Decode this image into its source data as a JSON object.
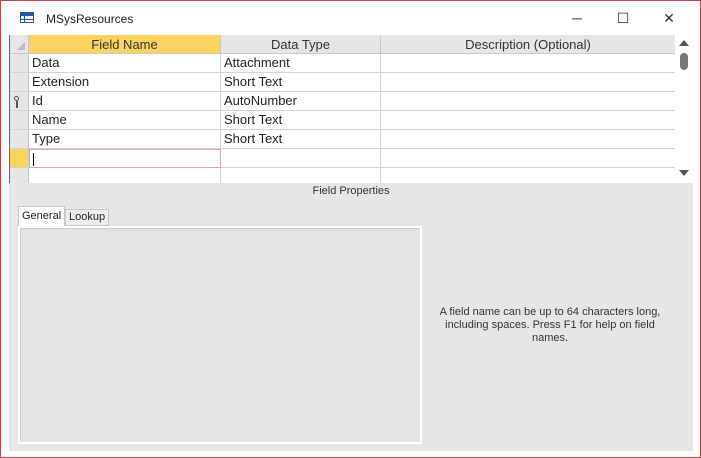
{
  "window": {
    "title": "MSysResources",
    "title_icon": "table-icon"
  },
  "controls": {
    "minimize": "─",
    "maximize": "☐",
    "close": "✕"
  },
  "grid": {
    "columns": [
      "Field Name",
      "Data Type",
      "Description (Optional)"
    ],
    "rows": [
      {
        "field": "Data",
        "type": "Attachment",
        "description": "",
        "primary_key": false
      },
      {
        "field": "Extension",
        "type": "Short Text",
        "description": "",
        "primary_key": false
      },
      {
        "field": "Id",
        "type": "AutoNumber",
        "description": "",
        "primary_key": true
      },
      {
        "field": "Name",
        "type": "Short Text",
        "description": "",
        "primary_key": false
      },
      {
        "field": "Type",
        "type": "Short Text",
        "description": "",
        "primary_key": false
      }
    ]
  },
  "properties": {
    "title": "Field Properties",
    "tabs": [
      "General",
      "Lookup"
    ],
    "hint": "A field name can be up to 64 characters long, including spaces. Press F1 for help on field names."
  },
  "colors": {
    "accent": "#b9484c",
    "selected": "#fbd45f",
    "header": "#e6e6e6"
  }
}
